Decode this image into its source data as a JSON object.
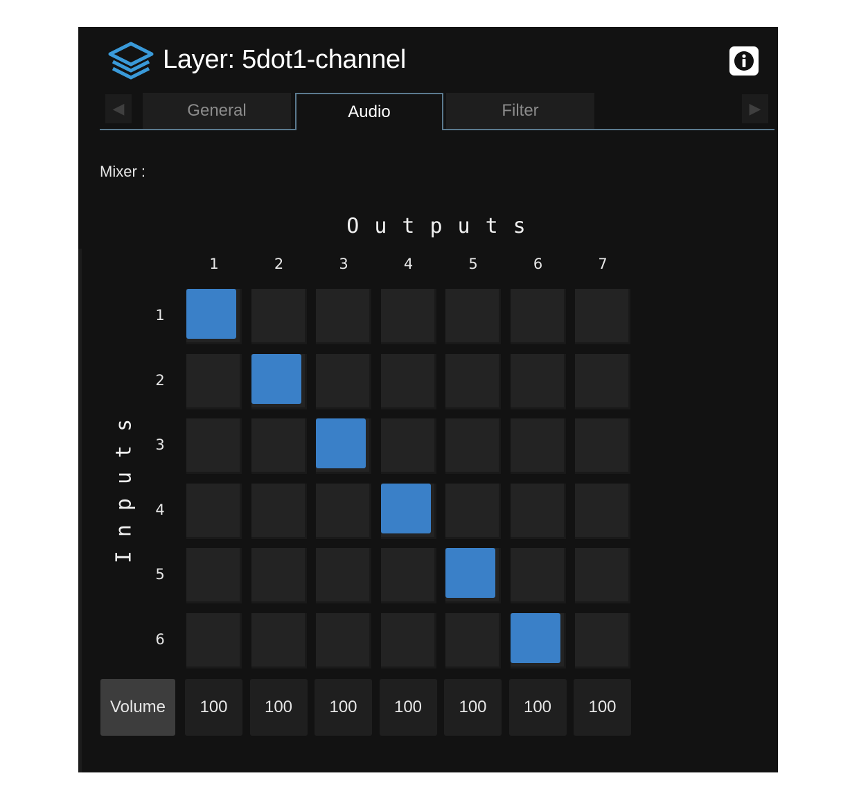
{
  "header": {
    "title": "Layer: 5dot1-channel",
    "layer_icon": "layers-icon",
    "info_icon": "info-icon",
    "accent_color": "#3a9ad9"
  },
  "tabs": {
    "prev_icon": "chevron-left-icon",
    "next_icon": "chevron-right-icon",
    "items": [
      {
        "label": "General",
        "active": false
      },
      {
        "label": "Audio",
        "active": true
      },
      {
        "label": "Filter",
        "active": false
      }
    ]
  },
  "mixer": {
    "label": "Mixer :",
    "outputs_label": "Outputs",
    "inputs_label": "Inputs",
    "outputs": [
      "1",
      "2",
      "3",
      "4",
      "5",
      "6",
      "7"
    ],
    "inputs": [
      "1",
      "2",
      "3",
      "4",
      "5",
      "6"
    ],
    "routing": [
      [
        1,
        0,
        0,
        0,
        0,
        0,
        0
      ],
      [
        0,
        1,
        0,
        0,
        0,
        0,
        0
      ],
      [
        0,
        0,
        1,
        0,
        0,
        0,
        0
      ],
      [
        0,
        0,
        0,
        1,
        0,
        0,
        0
      ],
      [
        0,
        0,
        0,
        0,
        1,
        0,
        0
      ],
      [
        0,
        0,
        0,
        0,
        0,
        1,
        0
      ]
    ],
    "active_color": "#3a80c8",
    "volume_label": "Volume",
    "volumes": [
      "100",
      "100",
      "100",
      "100",
      "100",
      "100",
      "100"
    ]
  }
}
